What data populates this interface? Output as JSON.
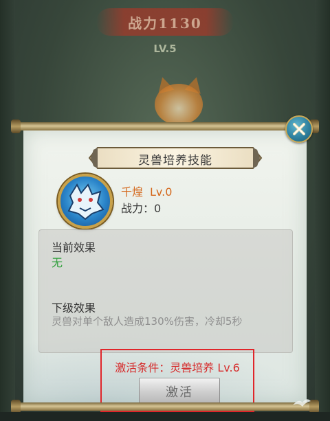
{
  "background": {
    "combat_power": "战力1130",
    "level": "LV.5"
  },
  "dialog": {
    "title": "灵兽培养技能",
    "skill": {
      "name": "千煌",
      "level": "Lv.0",
      "power_label": "战力：",
      "power_value": "0"
    },
    "current_effect": {
      "label": "当前效果",
      "value": "无"
    },
    "next_effect": {
      "label": "下级效果",
      "value": "灵兽对单个敌人造成130%伤害，冷却5秒"
    },
    "activation": {
      "condition": "激活条件：灵兽培养 Lv.6",
      "button_label": "激活"
    }
  },
  "colors": {
    "skill_name": "#d4671b",
    "current_value": "#2e9f3a",
    "condition": "#d62a2a",
    "highlight_box": "#e0252a"
  }
}
